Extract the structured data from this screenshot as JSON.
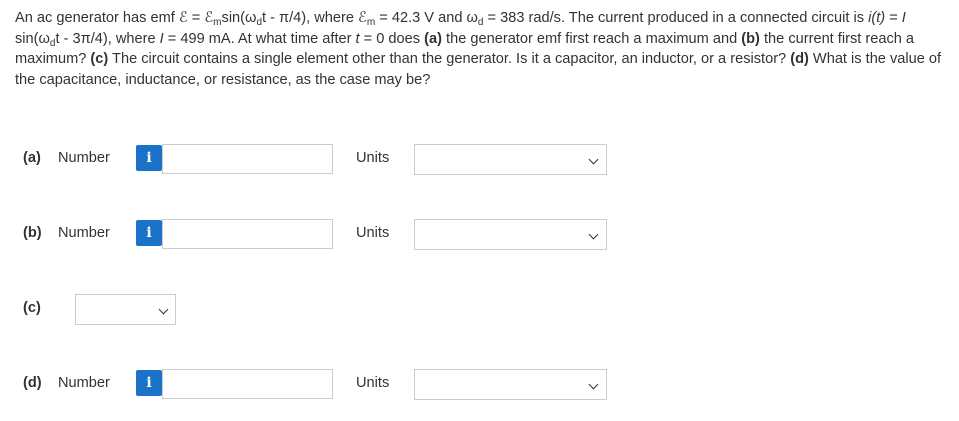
{
  "problem": {
    "p1": "An ac generator has emf ℰ = ℰ",
    "sub_m1": "m",
    "p2": "sin(ω",
    "sub_d1": "d",
    "p3": "t - π/4), where ℰ",
    "sub_m2": "m",
    "p4": " = 42.3 V and ω",
    "sub_d2": "d",
    "p5": " = 383 rad/s. The current produced in a connected circuit is ",
    "i_of_t": "i(t)",
    "p6": " = ",
    "I1": "I",
    "p7": " sin(ω",
    "sub_d3": "d",
    "p8": "t - 3π/4), where ",
    "I2": "I",
    "p9": " = 499 mA. At what time after ",
    "t_var": "t",
    "p10": " = 0 does ",
    "a_b": "(a)",
    "p11": " the generator emf first reach a maximum and ",
    "b_b": "(b)",
    "p12": " the current first reach a maximum? ",
    "c_b": "(c)",
    "p13": " The circuit contains a single element other than the generator. Is it a capacitor, an inductor, or a resistor? ",
    "d_b": "(d)",
    "p14": " What is the value of the capacitance, inductance, or resistance, as the case may be?"
  },
  "parts": {
    "a": {
      "label": "(a)",
      "number_label": "Number",
      "info_icon": "i",
      "value": "",
      "units_label": "Units",
      "units_value": ""
    },
    "b": {
      "label": "(b)",
      "number_label": "Number",
      "info_icon": "i",
      "value": "",
      "units_label": "Units",
      "units_value": ""
    },
    "c": {
      "label": "(c)",
      "select_value": ""
    },
    "d": {
      "label": "(d)",
      "number_label": "Number",
      "info_icon": "i",
      "value": "",
      "units_label": "Units",
      "units_value": ""
    }
  },
  "colors": {
    "info_button": "#1a73c9",
    "text": "#333333",
    "border": "#cccccc"
  }
}
